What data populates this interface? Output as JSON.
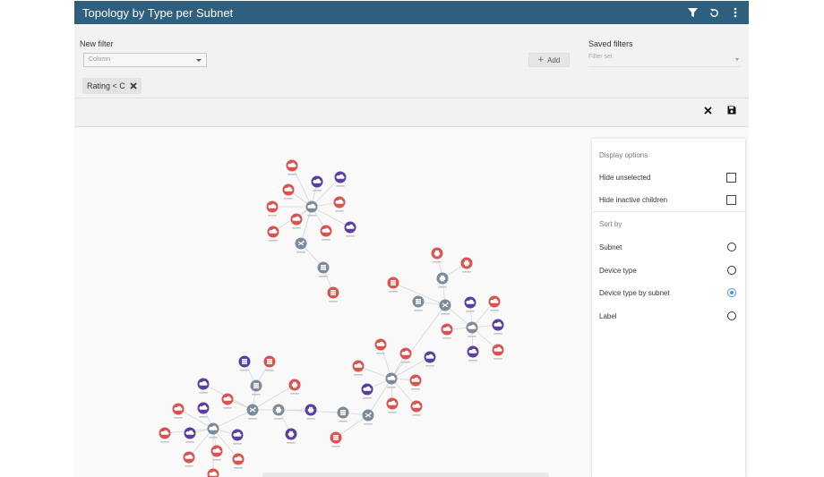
{
  "header": {
    "title": "Topology by Type per Subnet"
  },
  "filter": {
    "new_filter_label": "New filter",
    "column_placeholder": "Column",
    "add_label": "Add",
    "saved_filters_label": "Saved filters",
    "filter_set_placeholder": "Filter set",
    "chip_label": "Rating < C"
  },
  "options": {
    "display_title": "Display options",
    "hide_unselected": "Hide unselected",
    "hide_unselected_checked": false,
    "hide_inactive_children": "Hide inactive children",
    "hide_inactive_checked": false,
    "sort_title": "Sort by",
    "sort_items": [
      "Subnet",
      "Device type",
      "Device type by subnet",
      "Label"
    ],
    "sort_selected": "Device type by subnet"
  },
  "colors": {
    "header": "#2e5f7e",
    "red_node": "#d9534f",
    "purple_node": "#5b3fa0",
    "gray_node": "#7d8b99",
    "radio_active": "#4a90e2"
  }
}
